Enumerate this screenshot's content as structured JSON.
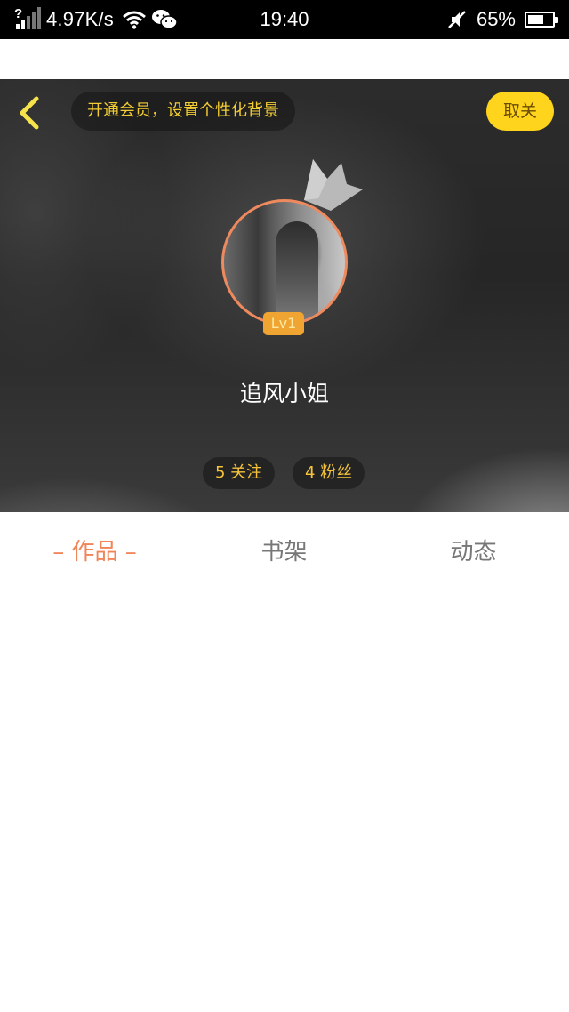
{
  "status_bar": {
    "signal_marker": "?",
    "network_speed": "4.97K/s",
    "time": "19:40",
    "battery_percent": "65%",
    "battery_level": 0.65,
    "icons": [
      "signal-icon",
      "wifi-icon",
      "wechat-icon",
      "mute-icon",
      "battery-icon"
    ]
  },
  "profile_header": {
    "back_icon": "chevron-left-icon",
    "vip_banner": "开通会员，设置个性化背景",
    "unfollow_label": "取关",
    "level_badge": "Lv1",
    "username": "追风小姐",
    "following": "5 关注",
    "fans": "4 粉丝",
    "accent_color": "#ffd41c",
    "avatar_ring_color": "#ee8a5e"
  },
  "tabs": {
    "active_index": 0,
    "items": [
      {
        "label": "– 作品 –"
      },
      {
        "label": "书架"
      },
      {
        "label": "动态"
      }
    ],
    "active_color": "#f0855a",
    "inactive_color": "#777777"
  }
}
